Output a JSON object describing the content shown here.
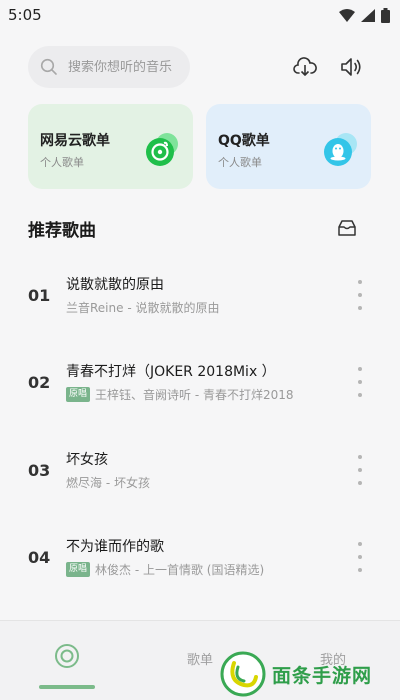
{
  "status_bar": {
    "time": "5:05"
  },
  "search": {
    "placeholder": "搜索你想听的音乐"
  },
  "cards": [
    {
      "title": "网易云歌单",
      "subtitle": "个人歌单",
      "accent": "#1fbf4a"
    },
    {
      "title": "QQ歌单",
      "subtitle": "个人歌单",
      "accent": "#33c5e8"
    }
  ],
  "section": {
    "title": "推荐歌曲"
  },
  "songs": [
    {
      "num": "01",
      "title": "说散就散的原由",
      "tag": "",
      "artist": "兰音Reine - 说散就散的原由"
    },
    {
      "num": "02",
      "title": "青春不打烊（JOKER 2018Mix ）",
      "tag": "原唱",
      "artist": "王梓钰、音阙诗听 - 青春不打烊2018"
    },
    {
      "num": "03",
      "title": "坏女孩",
      "tag": "",
      "artist": "燃尽海 - 坏女孩"
    },
    {
      "num": "04",
      "title": "不为谁而作的歌",
      "tag": "原唱",
      "artist": "林俊杰 - 上一首情歌 (国语精选)"
    }
  ],
  "bottom_nav": {
    "items": [
      {
        "icon": "home-disc-icon",
        "label": "",
        "active": true
      },
      {
        "label": "歌单"
      },
      {
        "label": "我的"
      }
    ],
    "accent": "#7cbb8a"
  },
  "watermark": {
    "text": "面条手游网"
  }
}
